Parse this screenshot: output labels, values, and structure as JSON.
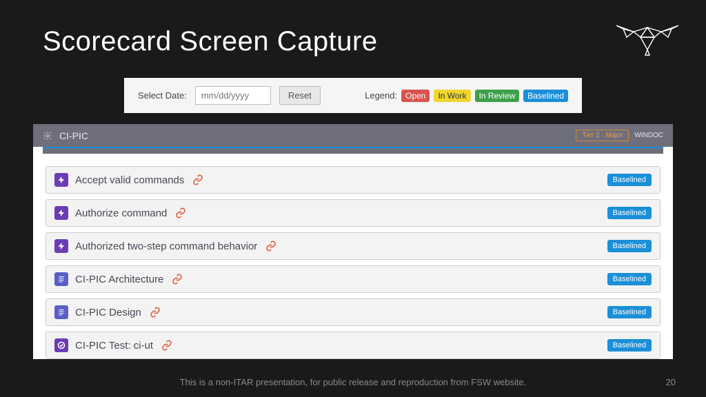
{
  "slide": {
    "title": "Scorecard Screen Capture",
    "footer_text": "This is a non-ITAR presentation, for public release and reproduction from FSW website.",
    "page_number": "20"
  },
  "toolbar": {
    "select_date_label": "Select Date:",
    "date_placeholder": "mm/dd/yyyy",
    "reset_label": "Reset",
    "legend_label": "Legend:",
    "legend": {
      "open": "Open",
      "in_work": "In Work",
      "in_review": "In Review",
      "baselined": "Baselined"
    }
  },
  "panel": {
    "title": "CI-PIC",
    "tier_badge": "Tier 2 · Major",
    "windoc": "WINDOC"
  },
  "items": [
    {
      "icon": "bolt",
      "label": "Accept valid commands",
      "status": "Baselined"
    },
    {
      "icon": "bolt",
      "label": "Authorize command",
      "status": "Baselined"
    },
    {
      "icon": "bolt",
      "label": "Authorized two-step command behavior",
      "status": "Baselined"
    },
    {
      "icon": "doc",
      "label": "CI-PIC Architecture",
      "status": "Baselined"
    },
    {
      "icon": "doc",
      "label": "CI-PIC Design",
      "status": "Baselined"
    },
    {
      "icon": "check",
      "label": "CI-PIC Test: ci-ut",
      "status": "Baselined"
    }
  ]
}
